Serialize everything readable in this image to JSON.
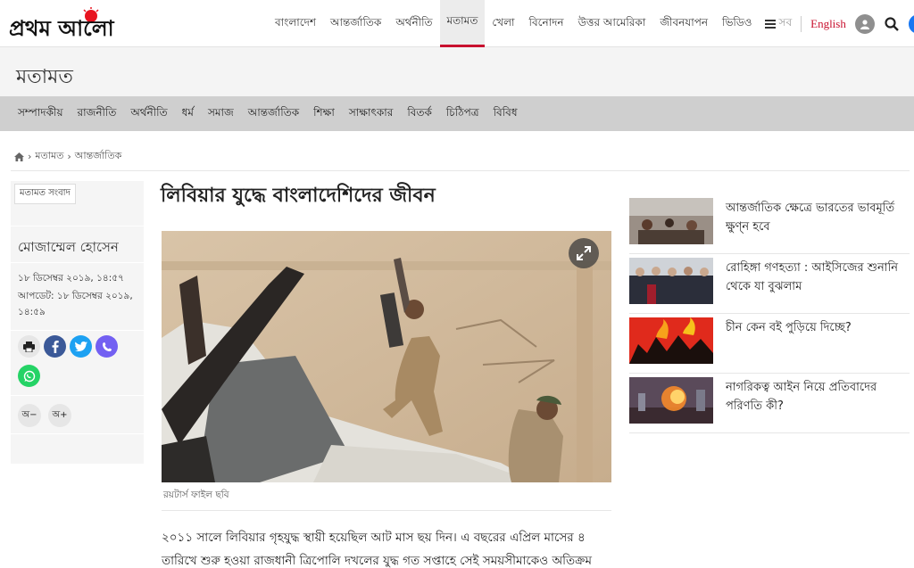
{
  "header": {
    "logo_text": "প্রথম আলো",
    "nav": [
      "বাংলাদেশ",
      "আন্তর্জাতিক",
      "অর্থনীতি",
      "মতামত",
      "খেলা",
      "বিনোদন",
      "উত্তর আমেরিকা",
      "জীবনযাপন",
      "ভিডিও"
    ],
    "active_nav": "মতামত",
    "menu_label": "সব",
    "english_label": "English"
  },
  "section": {
    "title": "মতামত",
    "subnav": [
      "সম্পাদকীয়",
      "রাজনীতি",
      "অর্থনীতি",
      "ধর্ম",
      "সমাজ",
      "আন্তর্জাতিক",
      "শিক্ষা",
      "সাক্ষাৎকার",
      "বিতর্ক",
      "চিঠিপত্র",
      "বিবিধ"
    ]
  },
  "breadcrumb": [
    "মতামত",
    "আন্তর্জাতিক"
  ],
  "article": {
    "tag": "মতামত সংবাদ",
    "author": "মোজাম্মেল হোসেন",
    "published": "১৮ ডিসেম্বর ২০১৯, ১৪:৫৭",
    "updated": "আপডেট: ১৮ ডিসেম্বর ২০১৯, ১৪:৫৯",
    "font_down": "অ−",
    "font_up": "অ+",
    "headline": "লিবিয়ার যুদ্ধে বাংলাদেশিদের জীবন",
    "caption": "রয়টার্স ফাইল ছবি",
    "body_lines": [
      "২০১১ সালে লিবিয়ার গৃহযুদ্ধ স্থায়ী হয়েছিল আট মাস ছয় দিন। এ বছরের এপ্রিল মাসের ৪",
      "তারিখে শুরু হওয়া রাজধানী ত্রিপোলি দখলের যুদ্ধ গত সপ্তাহে সেই সময়সীমাকেও অতিক্রম করে"
    ]
  },
  "related": [
    {
      "title_lines": [
        "আন্তর্জাতিক ক্ষেত্রে ভারতের ভাবমূর্তি",
        "ক্ষুণ্ন হবে"
      ]
    },
    {
      "title_lines": [
        "রোহিঙ্গা গণহত্যা : আইসিজের শুনানি",
        "থেকে যা বুঝলাম"
      ]
    },
    {
      "title_lines": [
        "চীন কেন বই পুড়িয়ে দিচ্ছে?"
      ]
    },
    {
      "title_lines": [
        "নাগরিকত্ব আইন নিয়ে প্রতিবাদের",
        "পরিণতি কী?"
      ]
    }
  ],
  "colors": {
    "brand": "#c8102e",
    "facebook": "#3b5998",
    "twitter": "#1da1f2",
    "viber": "#7360f2",
    "whatsapp": "#25d366"
  }
}
